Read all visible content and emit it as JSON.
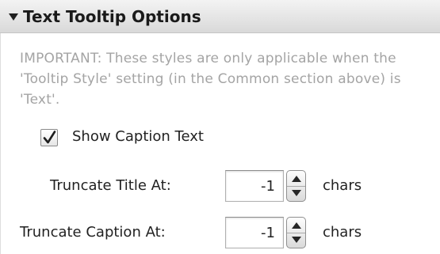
{
  "section": {
    "title": "Text Tooltip Options",
    "expanded": true
  },
  "note": "IMPORTANT: These styles are only applicable when the 'Tooltip Style' setting (in the Common section above) is 'Text'.",
  "show_caption": {
    "label": "Show Caption Text",
    "checked": true
  },
  "truncate_title": {
    "label": "Truncate Title At:",
    "value": "-1",
    "unit": "chars"
  },
  "truncate_caption": {
    "label": "Truncate Caption At:",
    "value": "-1",
    "unit": "chars"
  }
}
